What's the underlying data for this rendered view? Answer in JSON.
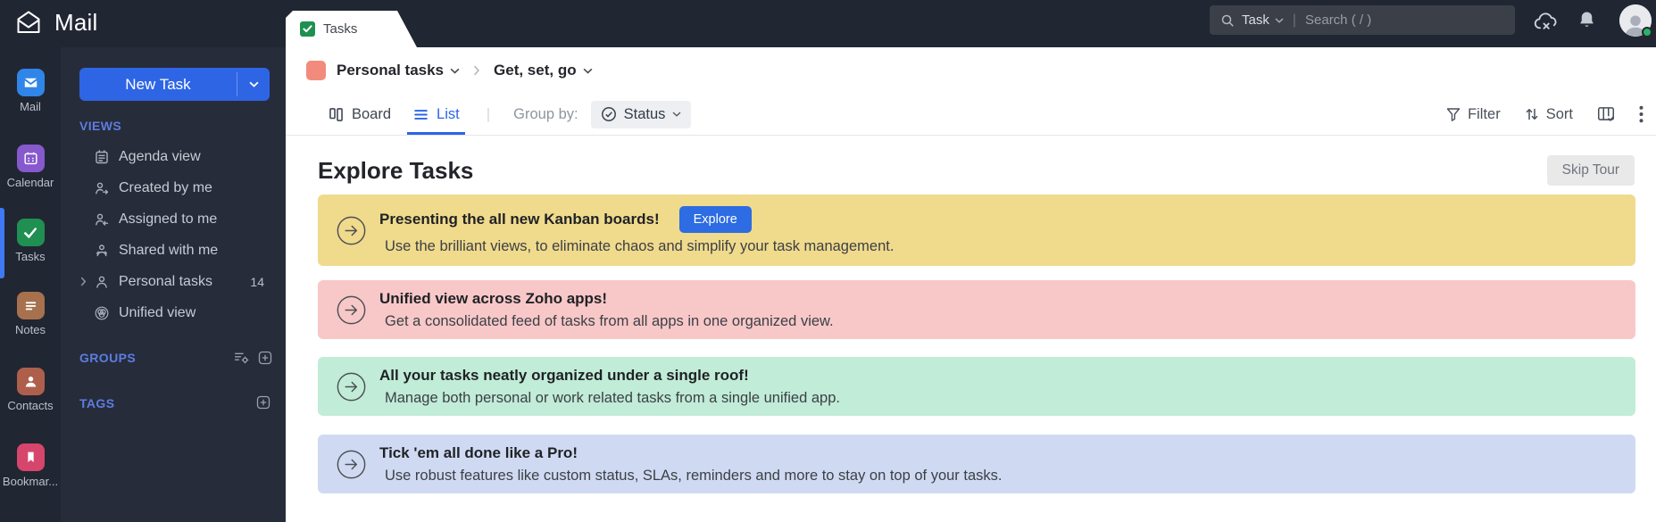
{
  "header": {
    "app_title": "Mail",
    "tab_label": "Tasks",
    "search": {
      "scope_label": "Task",
      "placeholder": "Search ( / )"
    }
  },
  "rail": {
    "items": [
      {
        "label": "Mail",
        "color": "#2f86e8"
      },
      {
        "label": "Calendar",
        "color": "#8659cd"
      },
      {
        "label": "Tasks",
        "color": "#1f9051"
      },
      {
        "label": "Notes",
        "color": "#a7714e"
      },
      {
        "label": "Contacts",
        "color": "#ae5f4c"
      },
      {
        "label": "Bookmar...",
        "color": "#d6456b"
      }
    ]
  },
  "sidebar": {
    "new_task_label": "New Task",
    "views_label": "VIEWS",
    "views": [
      {
        "label": "Agenda view"
      },
      {
        "label": "Created by me"
      },
      {
        "label": "Assigned to me"
      },
      {
        "label": "Shared with me"
      },
      {
        "label": "Personal tasks",
        "count": "14"
      },
      {
        "label": "Unified view"
      }
    ],
    "groups_label": "GROUPS",
    "tags_label": "TAGS"
  },
  "breadcrumb": {
    "project_label": "Personal tasks",
    "page_label": "Get, set, go",
    "swatch_color": "#f28b7b"
  },
  "toolbar": {
    "board_label": "Board",
    "list_label": "List",
    "group_by_label": "Group by:",
    "group_by_value": "Status",
    "filter_label": "Filter",
    "sort_label": "Sort"
  },
  "content": {
    "title": "Explore Tasks",
    "skip_tour_label": "Skip Tour",
    "banners": [
      {
        "title": "Presenting the all new Kanban boards!",
        "subtitle": "Use the brilliant views, to eliminate chaos and simplify your task management.",
        "button_label": "Explore",
        "bg": "#f0da8c"
      },
      {
        "title": "Unified view across Zoho apps!",
        "subtitle": "Get a consolidated feed of tasks from all apps in one organized view.",
        "bg": "#f8c8c8"
      },
      {
        "title": "All your tasks neatly organized under a single roof!",
        "subtitle": "Manage both personal or work related tasks from a single unified app.",
        "bg": "#c1ecd8"
      },
      {
        "title": "Tick 'em all done like a Pro!",
        "subtitle": "Use robust features like custom status, SLAs, reminders and more to stay on top of your tasks.",
        "bg": "#cfdaf2"
      }
    ]
  },
  "colors": {
    "accent_blue": "#2e65e5",
    "active_indicator": "#3f79f3",
    "topbar_bg": "#212633",
    "sidebar_bg": "#262c3a",
    "tasks_green": "#1f9051",
    "presence_green": "#27b463"
  }
}
